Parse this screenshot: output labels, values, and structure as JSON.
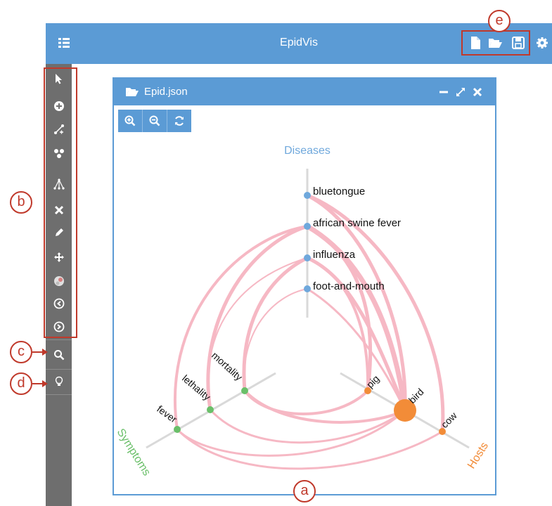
{
  "app": {
    "title": "EpidVis",
    "header_icons": [
      "menu-list-icon",
      "new-file-icon",
      "open-folder-icon",
      "save-icon",
      "gear-icon"
    ]
  },
  "sidebar": {
    "tools": [
      "pointer-icon",
      "add-node-icon",
      "add-edge-icon",
      "cluster-icon",
      "hierarchy-icon",
      "delete-icon",
      "edit-pencil-icon",
      "move-icon",
      "color-palette-icon",
      "collapse-icon",
      "expand-icon"
    ],
    "extra_tools": [
      "search-icon",
      "lightbulb-icon"
    ]
  },
  "window": {
    "filename": "Epid.json",
    "controls": [
      "minimize-icon",
      "maximize-icon",
      "close-icon"
    ],
    "zoom_controls": [
      "zoom-in-icon",
      "zoom-out-icon",
      "refresh-icon"
    ]
  },
  "hiveplot": {
    "axes": {
      "diseases": "Diseases",
      "symptoms": "Symptoms",
      "hosts": "Hosts"
    },
    "colors": {
      "diseases": "#6fa8dc",
      "symptoms": "#6abf69",
      "hosts": "#f28c38",
      "links": "#f6b8c4",
      "axis": "#d9d9d9"
    },
    "diseases": [
      "bluetongue",
      "african swine fever",
      "influenza",
      "foot-and-mouth"
    ],
    "symptoms": [
      "fever",
      "lethality",
      "mortality"
    ],
    "hosts": [
      "pig",
      "bird",
      "cow"
    ]
  },
  "callouts": {
    "a": "a",
    "b": "b",
    "c": "c",
    "d": "d",
    "e": "e"
  }
}
